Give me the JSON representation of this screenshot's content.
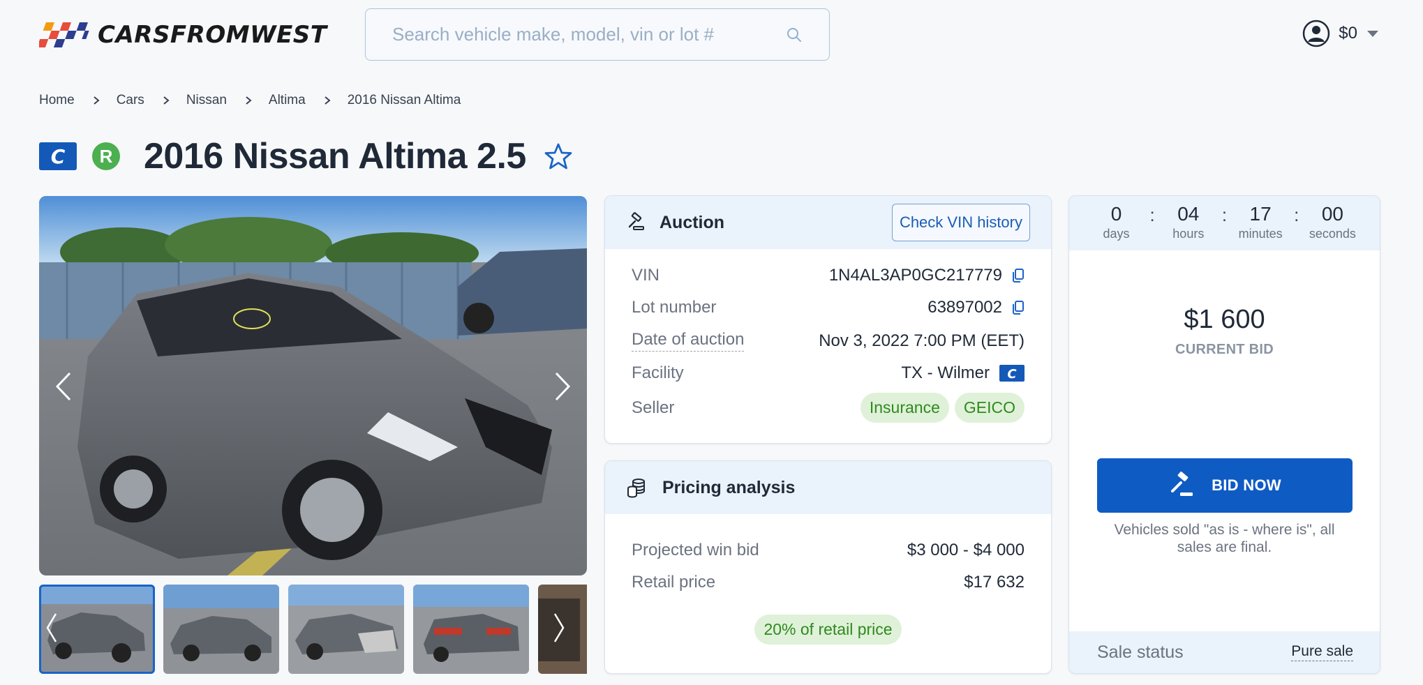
{
  "header": {
    "logo_text": "CARSFROMWEST",
    "search_placeholder": "Search vehicle make, model, vin or lot #",
    "balance": "$0"
  },
  "breadcrumb": [
    "Home",
    "Cars",
    "Nissan",
    "Altima",
    "2016 Nissan Altima"
  ],
  "title": {
    "badge_c": "C",
    "badge_r": "R",
    "text": "2016 Nissan Altima 2.5"
  },
  "gallery": {
    "thumbnail_count_visible": 5,
    "active_index": 0
  },
  "auction": {
    "heading": "Auction",
    "vin_button": "Check VIN history",
    "rows": [
      {
        "label": "VIN",
        "value": "1N4AL3AP0GC217779"
      },
      {
        "label": "Lot number",
        "value": "63897002"
      },
      {
        "label": "Date of auction",
        "value": "Nov 3, 2022 7:00 PM (EET)"
      },
      {
        "label": "Facility",
        "value": "TX - Wilmer"
      },
      {
        "label": "Seller",
        "tags": [
          "Insurance",
          "GEICO"
        ]
      }
    ]
  },
  "pricing": {
    "heading": "Pricing analysis",
    "rows": [
      {
        "label": "Projected win bid",
        "value": "$3 000 - $4 000"
      },
      {
        "label": "Retail price",
        "value": "$17 632"
      }
    ],
    "retail_badge": "20% of retail price"
  },
  "bid_panel": {
    "countdown": [
      {
        "value": "0",
        "label": "days"
      },
      {
        "value": "04",
        "label": "hours"
      },
      {
        "value": "17",
        "label": "minutes"
      },
      {
        "value": "00",
        "label": "seconds"
      }
    ],
    "current_bid": "$1 600",
    "current_bid_label": "CURRENT BID",
    "bid_button": "BID NOW",
    "disclaimer": "Vehicles sold \"as is - where is\", all sales are final.",
    "sale_status_label": "Sale status",
    "sale_status_value": "Pure sale"
  },
  "colors": {
    "brand_blue": "#0f5bc4",
    "panel_tint": "#eaf2fb",
    "tag_green_bg": "#dff1d8",
    "tag_green_text": "#2f8a1f",
    "badge_r_green": "#4caf50"
  }
}
